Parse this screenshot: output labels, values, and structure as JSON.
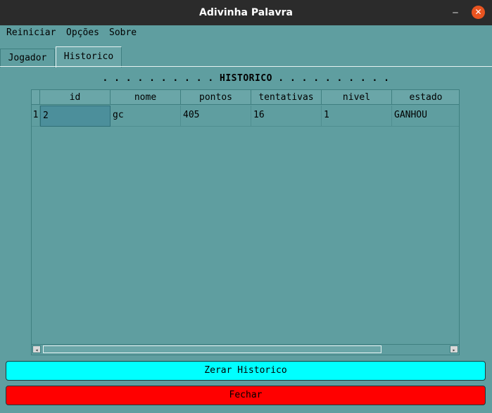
{
  "window": {
    "title": "Adivinha Palavra",
    "minimize_glyph": "‒",
    "close_glyph": "✕"
  },
  "menu": {
    "items": [
      "Reiniciar",
      "Opções",
      "Sobre"
    ]
  },
  "tabs": [
    {
      "label": "Jogador",
      "active": false
    },
    {
      "label": "Historico",
      "active": true
    }
  ],
  "historico": {
    "heading": ". . . . . . . . . . HISTORICO . . . . . . . . . .",
    "columns": [
      "id",
      "nome",
      "pontos",
      "tentativas",
      "nivel",
      "estado"
    ],
    "rows": [
      {
        "num": "1",
        "cells": [
          "2",
          "gc",
          "405",
          "16",
          "1",
          "GANHOU"
        ]
      }
    ],
    "scroll_left": "◂",
    "scroll_right": "▸"
  },
  "buttons": {
    "zerar": "Zerar Historico",
    "fechar": "Fechar"
  },
  "colors": {
    "background": "#5f9ea0",
    "zerar_button": "#00ffff",
    "fechar_button": "#ff0000",
    "close_button": "#e95420"
  }
}
